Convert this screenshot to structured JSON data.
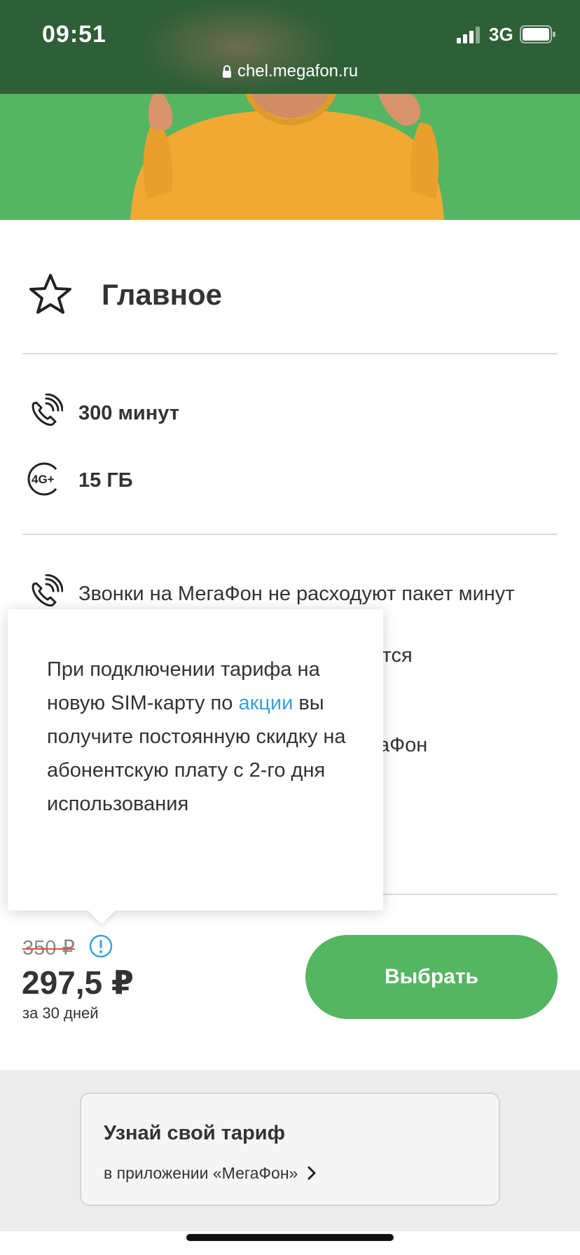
{
  "status_bar": {
    "time": "09:51",
    "network": "3G",
    "url": "chel.megafon.ru",
    "signal_icon": "signal-bars-icon",
    "battery_icon": "battery-icon",
    "lock_icon": "lock-icon"
  },
  "section": {
    "title": "Главное",
    "icon": "star-outline-icon"
  },
  "features": [
    {
      "icon": "phone-call-icon",
      "text": "300 минут"
    },
    {
      "icon": "4g-plus-icon",
      "text": "15 ГБ"
    }
  ],
  "options": {
    "calls_text": "Звонки на МегаФон не расходуют пакет минут",
    "partial_line_2": "отся",
    "partial_line_3": "гаФон"
  },
  "popover": {
    "text_before": "При подключении тарифа на новую SIM-карту по ",
    "link_text": "акции",
    "text_after": " вы получите постоянную скидку на абонентскую плату с 2-го дня использования"
  },
  "price": {
    "old_price": "350 ₽",
    "current_price": "297,5 ₽",
    "period": "за 30 дней",
    "select_button": "Выбрать"
  },
  "promo": {
    "title": "Узнай свой тариф",
    "link": "в приложении «МегаФон»"
  },
  "colors": {
    "brand_green": "#54b562",
    "status_bar": "#2e5f36",
    "link_blue": "#3aa0e0",
    "strike_red": "#e04a3f"
  }
}
